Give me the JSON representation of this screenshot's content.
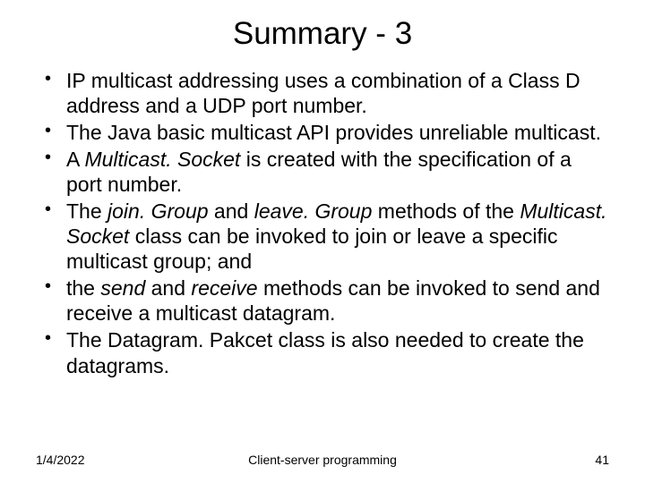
{
  "title": "Summary - 3",
  "bullets": [
    {
      "pre": "IP multicast addressing uses a combination of a Class D address and a UDP port number."
    },
    {
      "pre": "The Java basic multicast API provides unreliable multicast."
    },
    {
      "pre": "A ",
      "i1": "Multicast. Socket",
      "mid1": " is created with the specification of a port number."
    },
    {
      "pre": "The ",
      "i1": "join. Group",
      "mid1": " and ",
      "i2": "leave. Group",
      "mid2": " methods of the ",
      "i3": "Multicast. Socket",
      "mid3": " class can be invoked to join or leave a specific multicast group; and"
    },
    {
      "pre": "the ",
      "i1": "send",
      "mid1": " and ",
      "i2": "receive",
      "mid2": " methods can be invoked to send and receive a multicast datagram."
    },
    {
      "pre": "The Datagram. Pakcet class is also needed to create the datagrams."
    }
  ],
  "footer": {
    "date": "1/4/2022",
    "center": "Client-server programming",
    "page": "41"
  }
}
